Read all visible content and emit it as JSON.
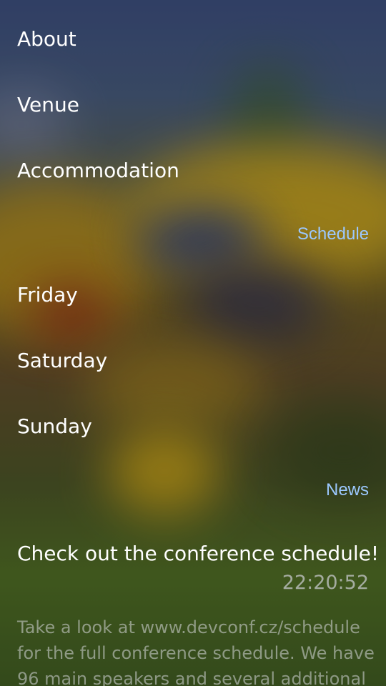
{
  "menu": {
    "items": [
      {
        "label": "About"
      },
      {
        "label": "Venue"
      },
      {
        "label": "Accommodation"
      }
    ]
  },
  "schedule": {
    "header": "Schedule",
    "days": [
      {
        "label": "Friday"
      },
      {
        "label": "Saturday"
      },
      {
        "label": "Sunday"
      }
    ]
  },
  "news": {
    "header": "News",
    "items": [
      {
        "title": "Check out the conference schedule!",
        "time": "22:20:52",
        "body": "Take a look at www.devconf.cz/schedule for the full conference schedule. We have 96 main speakers and several additional ones"
      }
    ]
  },
  "colors": {
    "section_header": "#9cc8ff",
    "text_primary": "#ffffff"
  }
}
